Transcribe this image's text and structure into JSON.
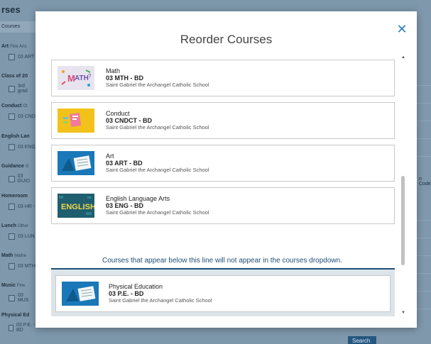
{
  "background": {
    "title": "rses",
    "tab_label": "Courses",
    "groups": [
      {
        "name": "Art",
        "sub": "Fine Arts",
        "item": "03 ART"
      },
      {
        "name": "Class of 20",
        "sub": "",
        "item": "3rd grad"
      },
      {
        "name": "Conduct",
        "sub": "Ot",
        "item": "03 CND"
      },
      {
        "name": "English Lan",
        "sub": "",
        "item": "03 ENG"
      },
      {
        "name": "Guidance",
        "sub": "G",
        "item": "03 GUID"
      },
      {
        "name": "Homeroom",
        "sub": "",
        "item": "03 HR -"
      },
      {
        "name": "Lunch",
        "sub": "Other",
        "item": "03 LUN"
      },
      {
        "name": "Math",
        "sub": "Mathe",
        "item": "03 MTH"
      },
      {
        "name": "Music",
        "sub": "Fine",
        "item": "03 MUS"
      },
      {
        "name": "Physical Ed",
        "sub": "",
        "item": "03 P.E. - BD"
      }
    ],
    "right_label": "n Code",
    "search_button": "Search"
  },
  "modal": {
    "title": "Reorder Courses",
    "close_icon": "close-icon",
    "visible_courses": [
      {
        "name": "Math",
        "code": "03 MTH - BD",
        "school": "Saint Gabriel the Archangel Catholic School",
        "thumb": "math-thumbnail"
      },
      {
        "name": "Conduct",
        "code": "03 CNDCT - BD",
        "school": "Saint Gabriel the Archangel Catholic School",
        "thumb": "conduct-thumbnail"
      },
      {
        "name": "Art",
        "code": "03 ART - BD",
        "school": "Saint Gabriel the Archangel Catholic School",
        "thumb": "art-thumbnail"
      },
      {
        "name": "English Language Arts",
        "code": "03 ENG - BD",
        "school": "Saint Gabriel the Archangel Catholic School",
        "thumb": "english-thumbnail"
      }
    ],
    "divider_text": "Courses that appear below this line will not appear in the courses dropdown.",
    "hidden_courses": [
      {
        "name": "Physical Education",
        "code": "03 P.E. - BD",
        "school": "Saint Gabriel the Archangel Catholic School",
        "thumb": "pe-thumbnail"
      }
    ]
  },
  "colors": {
    "accent": "#1f4e79",
    "close": "#2a7fbf",
    "overlay": "#7d97ab"
  }
}
